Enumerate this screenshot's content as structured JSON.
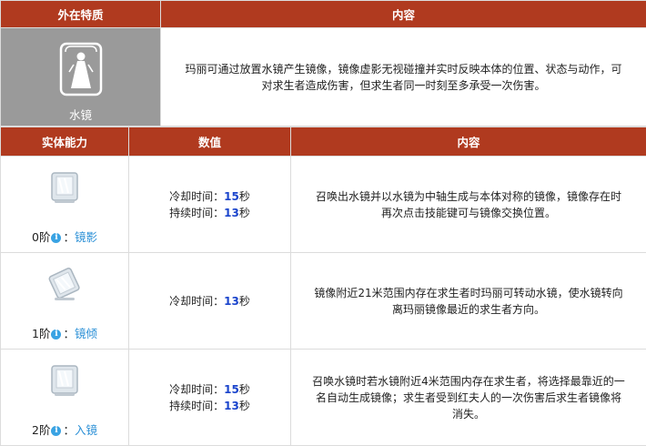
{
  "top_header": {
    "col1": "外在特质",
    "col2": "内容"
  },
  "trait": {
    "icon": "mirror-lady-icon",
    "label": "水镜",
    "content": "玛丽可通过放置水镜产生镜像，镜像虚影无视碰撞并实时反映本体的位置、状态与动作，可对求生者造成伤害，但求生者同一时刻至多承受一次伤害。"
  },
  "ability_header": {
    "col1": "实体能力",
    "col2": "数值",
    "col3": "内容"
  },
  "abilities": [
    {
      "icon": "mirror-icon",
      "tier": "0阶",
      "skill": "镜影",
      "stats": [
        {
          "label": "冷却时间：",
          "value": "15",
          "unit": "秒"
        },
        {
          "label": "持续时间：",
          "value": "13",
          "unit": "秒"
        }
      ],
      "content": "召唤出水镜并以水镜为中轴生成与本体对称的镜像，镜像存在时再次点击技能键可与镜像交换位置。"
    },
    {
      "icon": "tilted-mirror-icon",
      "tier": "1阶",
      "skill": "镜倾",
      "stats": [
        {
          "label": "冷却时间：",
          "value": "13",
          "unit": "秒"
        }
      ],
      "content": "镜像附近21米范围内存在求生者时玛丽可转动水镜，使水镜转向离玛丽镜像最近的求生者方向。"
    },
    {
      "icon": "mirror-icon",
      "tier": "2阶",
      "skill": "入镜",
      "stats": [
        {
          "label": "冷却时间：",
          "value": "15",
          "unit": "秒"
        },
        {
          "label": "持续时间：",
          "value": "13",
          "unit": "秒"
        }
      ],
      "content": "召唤水镜时若水镜附近4米范围内存在求生者，将选择最靠近的一名自动生成镜像；求生者受到红夫人的一次伤害后求生者镜像将消失。"
    }
  ],
  "colors": {
    "header_bg": "#b03a1f",
    "trait_bg": "#9a9a9a",
    "skill_link": "#2a8fd6",
    "stat_value": "#1a44cc",
    "info_icon": "#3aa3e3"
  }
}
